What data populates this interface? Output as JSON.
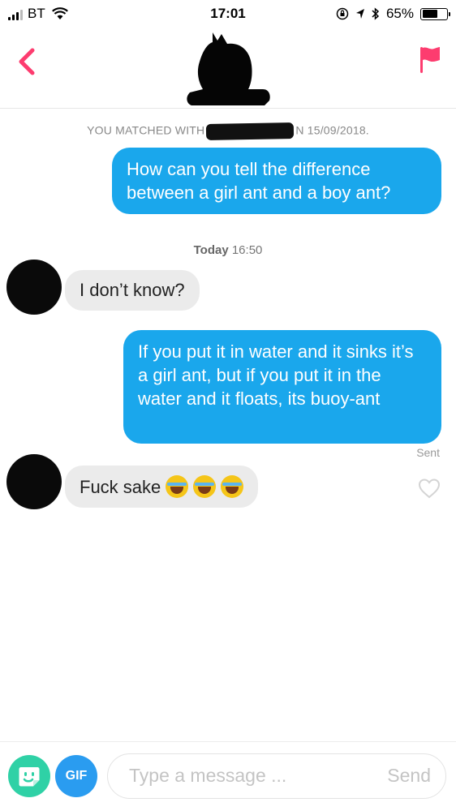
{
  "status_bar": {
    "carrier": "BT",
    "time": "17:01",
    "battery_percent": "65%",
    "battery_level": 0.65,
    "icons": [
      "signal-icon",
      "wifi-icon",
      "rotation-lock-icon",
      "location-icon",
      "bluetooth-icon",
      "battery-icon"
    ]
  },
  "header": {
    "back_icon": "chevron-left-icon",
    "report_icon": "flag-icon",
    "accent_color": "#fd3c6f"
  },
  "conversation": {
    "matched_prefix": "YOU MATCHED WITH",
    "matched_suffix": "N 15/09/2018.",
    "timestamp_day": "Today",
    "timestamp_time": "16:50",
    "messages": [
      {
        "direction": "outgoing",
        "text": "How can you tell the difference between a girl ant and a boy ant?"
      },
      {
        "direction": "incoming",
        "text": "I don’t know?"
      },
      {
        "direction": "outgoing",
        "text": "If you put it in water and it sinks it’s a girl ant, but if you put it in the water and it floats, its buoy-ant"
      },
      {
        "direction": "incoming",
        "text": "Fuck sake",
        "emoji": [
          "face-with-tears-of-joy",
          "face-with-tears-of-joy",
          "face-with-tears-of-joy"
        ]
      }
    ],
    "sent_label": "Sent",
    "outgoing_color": "#1aa7ec",
    "incoming_color": "#ebebeb"
  },
  "composer": {
    "sticker_icon": "sticker-icon",
    "gif_label": "GIF",
    "placeholder": "Type a message ...",
    "send_label": "Send"
  }
}
